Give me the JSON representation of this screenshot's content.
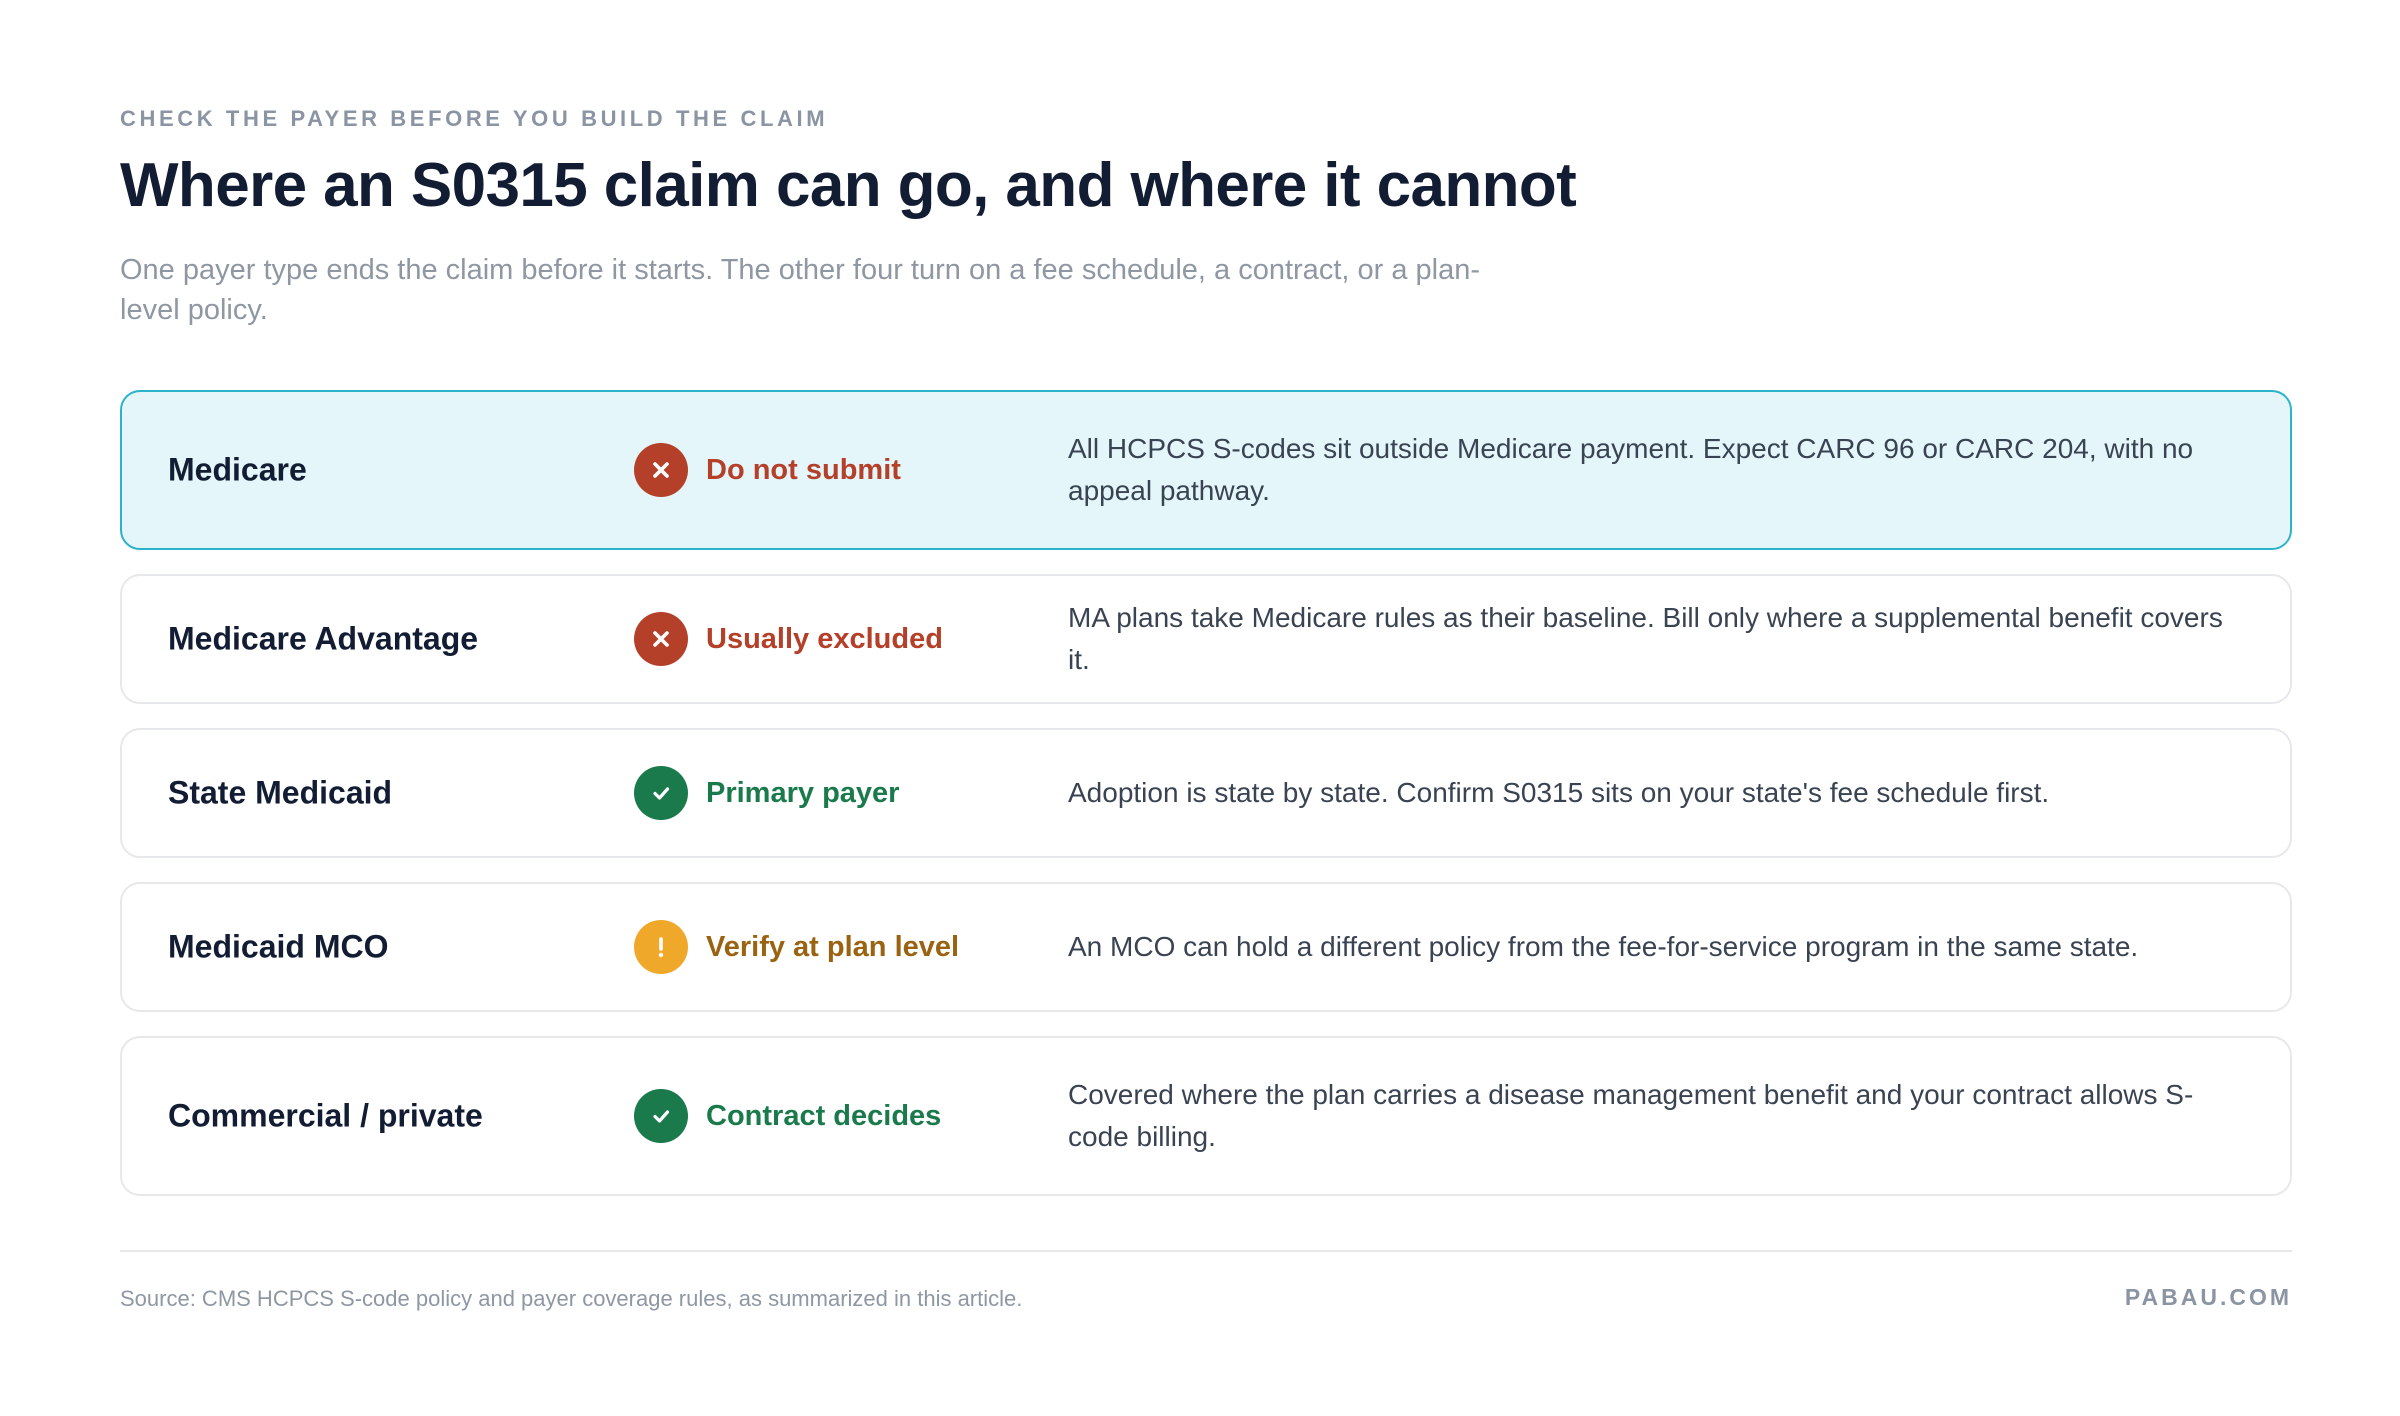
{
  "header": {
    "eyebrow": "CHECK THE PAYER BEFORE YOU BUILD THE CLAIM",
    "title": "Where an S0315 claim can go, and where it cannot",
    "subtitle": "One payer type ends the claim before it starts. The other four turn on a fee schedule, a contract, or a plan-level policy."
  },
  "colors": {
    "deny": "#b5402a",
    "approve": "#1a7a4c",
    "verify_icon": "#f0a82a",
    "verify_text": "#9a6312",
    "highlight_bg": "#e4f6fa",
    "highlight_border": "#2bb3c9"
  },
  "payers": [
    {
      "payer": "Medicare",
      "status": "Do not submit",
      "status_type": "deny",
      "icon": "x-circle-icon",
      "note": "All HCPCS S-codes sit outside Medicare payment. Expect CARC 96 or CARC 204, with no appeal pathway.",
      "highlighted": true
    },
    {
      "payer": "Medicare Advantage",
      "status": "Usually excluded",
      "status_type": "deny",
      "icon": "x-circle-icon",
      "note": "MA plans take Medicare rules as their baseline. Bill only where a supplemental benefit covers it.",
      "highlighted": false
    },
    {
      "payer": "State Medicaid",
      "status": "Primary payer",
      "status_type": "approve",
      "icon": "check-circle-icon",
      "note": "Adoption is state by state. Confirm S0315 sits on your state's fee schedule first.",
      "highlighted": false
    },
    {
      "payer": "Medicaid MCO",
      "status": "Verify at plan level",
      "status_type": "verify",
      "icon": "exclamation-circle-icon",
      "note": "An MCO can hold a different policy from the fee-for-service program in the same state.",
      "highlighted": false
    },
    {
      "payer": "Commercial / private",
      "status": "Contract decides",
      "status_type": "approve",
      "icon": "check-circle-icon",
      "note": "Covered where the plan carries a disease management benefit and your contract allows S-code billing.",
      "highlighted": false
    }
  ],
  "footer": {
    "source": "Source: CMS HCPCS S-code policy and payer coverage rules, as summarized in this article.",
    "brand": "PABAU.COM"
  }
}
